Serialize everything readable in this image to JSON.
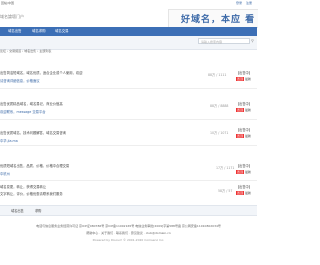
{
  "top": {
    "site_label": "回帖/中国",
    "login": "登录",
    "register": "注册"
  },
  "logo_text": "域名論壇门户",
  "banner": {
    "text": "好域名，本应 看"
  },
  "nav": {
    "items": [
      "域名出售",
      "域名求购",
      "域名交易"
    ]
  },
  "search": {
    "placeholder": "请输入搜索内容"
  },
  "crumb": "论坛 › 交易频道 › 域名出售 ›  主题列表",
  "posts": [
    {
      "line1": "出售简洁短域名，域名优质，适合企业或个人使用，欢迎",
      "line2": "请咨询详细信息，价格面议",
      "count": "88万 / 1111",
      "last_user": "【出售中】",
      "last_tag": "置顶",
      "last_date": "最新"
    },
    {
      "line1": "出售优质精品域名，域名易记，商业价值高",
      "line2": "欢迎联系，message 交易平台",
      "count": "88万 / 8888",
      "last_user": "【出售中】",
      "last_tag": "置顶",
      "last_date": "最新"
    },
    {
      "line1": "出售优质域名，技术问题解答，域名交易咨询",
      "line2": "中华.jia.ma",
      "count": "10万 / 1071",
      "last_user": "【出售中】",
      "last_tag": "置顶",
      "last_date": "最新"
    },
    {
      "line1": "优质短域名出售，品质、价格、价格中合理交易",
      "line2": "中杭州",
      "count": "17万 / 1171",
      "last_user": "【出售中】",
      "last_tag": "置顶",
      "last_date": "最新"
    },
    {
      "line1": "域名变更，转让，获得交易转让",
      "line2": "文字转让，评价，价格优惠请联系我们服务",
      "count": "58万 / 57",
      "last_user": "【出售中】",
      "last_tag": "置顶",
      "last_date": "最新"
    }
  ],
  "footer_tabs": [
    "域名出售",
    "求购"
  ],
  "footer": {
    "line1": "电话与信息服务业务经营许可证  京ICP证080786号  京ICP备11002165号  电信业务审批[2009]字第588号函  京公网安备11010802034号",
    "line2": "帮助中心 · 关于我们 · 联系我们 · 意见建议 · club@domain.cn",
    "line3": "Powered by Discuz! © 2001-2020 Comsenz Inc."
  }
}
